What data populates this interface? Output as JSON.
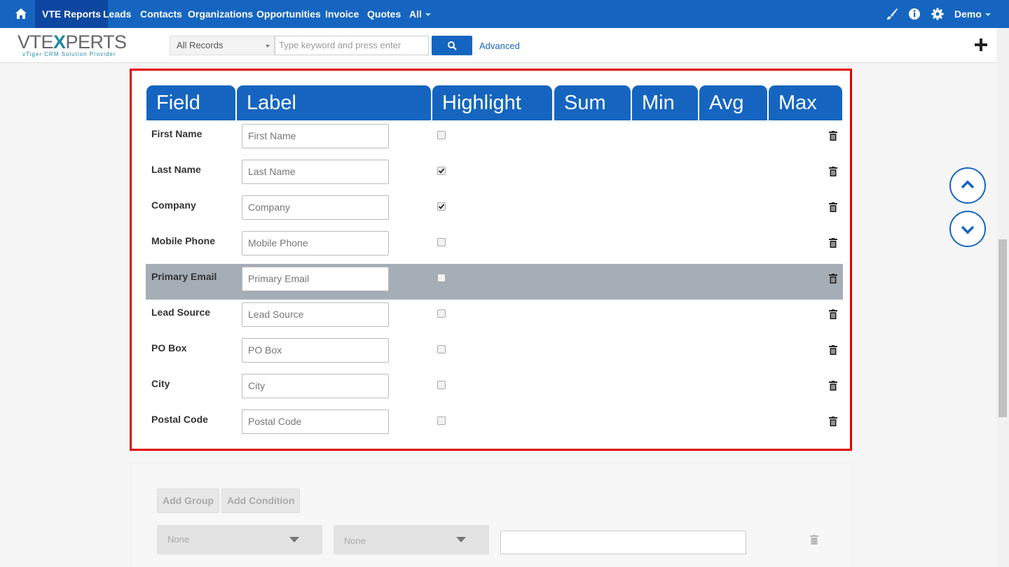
{
  "nav": {
    "items": [
      {
        "label": "VTE Reports",
        "active": true
      },
      {
        "label": "Leads"
      },
      {
        "label": "Contacts"
      },
      {
        "label": "Organizations"
      },
      {
        "label": "Opportunities"
      },
      {
        "label": "Invoice"
      },
      {
        "label": "Quotes"
      },
      {
        "label": "All"
      }
    ],
    "user": "Demo",
    "icons": [
      "home-icon",
      "brush-icon",
      "info-icon",
      "gear-icon"
    ]
  },
  "header": {
    "logo_main": "VTE",
    "logo_x": "X",
    "logo_rest": "PERTS",
    "logo_tagline": "vTiger CRM Solution Provider",
    "records_select": "All Records",
    "search_placeholder": "Type keyword and press enter",
    "advanced": "Advanced"
  },
  "table": {
    "columns": [
      "Field",
      "Label",
      "Highlight",
      "Sum",
      "Min",
      "Avg",
      "Max"
    ],
    "rows": [
      {
        "field": "First Name",
        "label": "First Name",
        "highlight": false
      },
      {
        "field": "Last Name",
        "label": "Last Name",
        "highlight": true
      },
      {
        "field": "Company",
        "label": "Company",
        "highlight": true
      },
      {
        "field": "Mobile Phone",
        "label": "Mobile Phone",
        "highlight": false
      },
      {
        "field": "Primary Email",
        "label": "Primary Email",
        "highlight": false,
        "selected": true
      },
      {
        "field": "Lead Source",
        "label": "Lead Source",
        "highlight": false
      },
      {
        "field": "PO Box",
        "label": "PO Box",
        "highlight": false
      },
      {
        "field": "City",
        "label": "City",
        "highlight": false
      },
      {
        "field": "Postal Code",
        "label": "Postal Code",
        "highlight": false
      }
    ]
  },
  "conditions": {
    "add_group": "Add Group",
    "add_condition": "Add Condition",
    "select1": "None",
    "select2": "None"
  },
  "colors": {
    "primary": "#1565c0",
    "highlight_border": "#e00000",
    "selected_row": "#a5adb6"
  }
}
